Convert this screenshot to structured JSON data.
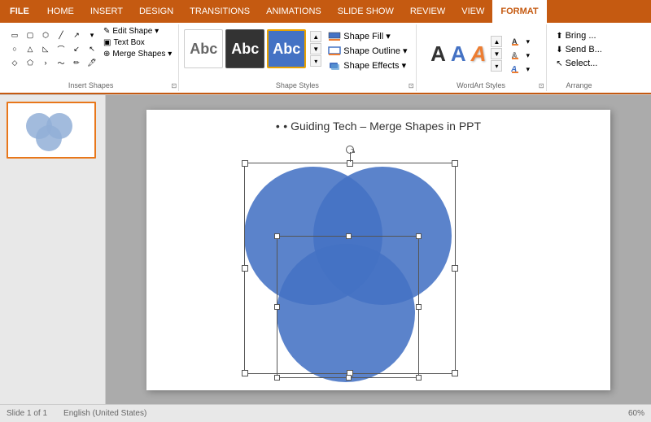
{
  "tabs": [
    "FILE",
    "HOME",
    "INSERT",
    "DESIGN",
    "TRANSITIONS",
    "ANIMATIONS",
    "SLIDE SHOW",
    "REVIEW",
    "VIEW",
    "FORMAT"
  ],
  "active_tab": "FORMAT",
  "groups": {
    "insert_shapes": {
      "label": "Insert Shapes",
      "edit_shape": "Edit Shape ▾",
      "text_box": "Text Box",
      "merge_shapes": "Merge Shapes ▾"
    },
    "shape_styles": {
      "label": "Shape Styles",
      "buttons": [
        "Abc",
        "Abc",
        "Abc"
      ],
      "commands": {
        "fill": "Shape Fill ▾",
        "outline": "Shape Outline ▾",
        "effects": "Shape Effects ▾"
      }
    },
    "wordart_styles": {
      "label": "WordArt Styles"
    },
    "arrange": {
      "label": "Arrange",
      "bring": "Bring ...",
      "send": "Send B...",
      "select": "Select..."
    }
  },
  "slide": {
    "title": "• Guiding Tech – Merge Shapes in PPT"
  },
  "status": {
    "slide_count": "Slide 1 of 1",
    "language": "English (United States)",
    "zoom": "60%"
  }
}
